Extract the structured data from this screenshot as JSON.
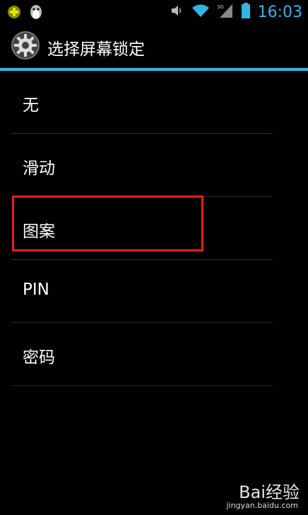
{
  "statusbar": {
    "time": "16:03",
    "icons": [
      "app-plus-icon",
      "qq-penguin-icon",
      "volume-icon",
      "wifi-icon",
      "signal-3g-icon",
      "battery-icon"
    ],
    "network_label": "3G"
  },
  "actionbar": {
    "title": "选择屏幕锁定",
    "icon": "settings-gear-icon"
  },
  "options": [
    {
      "label": "无"
    },
    {
      "label": "滑动"
    },
    {
      "label": "图案"
    },
    {
      "label": "PIN"
    },
    {
      "label": "密码"
    }
  ],
  "highlight": {
    "target": "图案",
    "color": "#e0201b"
  },
  "watermark": {
    "brand": "Bai经验",
    "url": "jingyan.baidu.com"
  },
  "colors": {
    "accent": "#33b5e5",
    "background": "#000000",
    "text": "#ffffff"
  }
}
